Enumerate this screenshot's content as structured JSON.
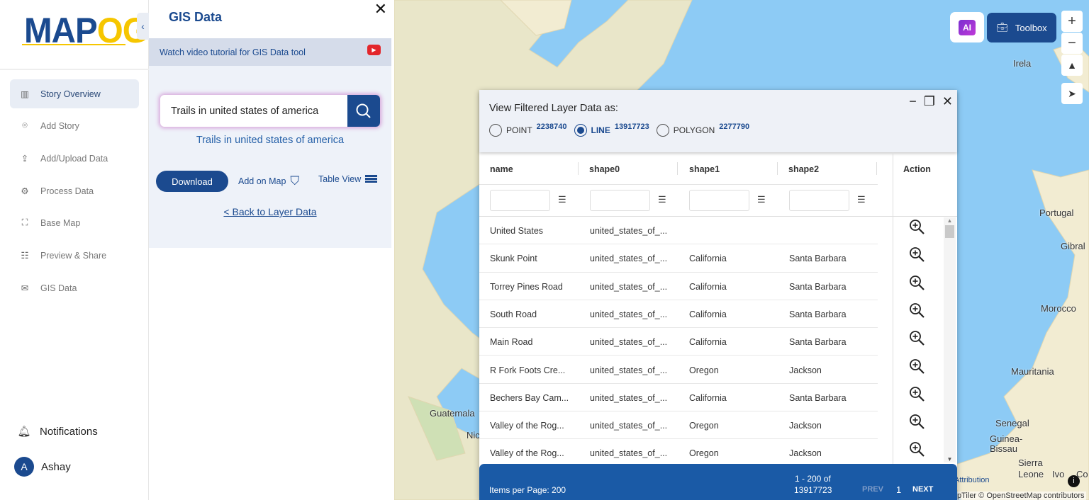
{
  "sidebar": {
    "logo": "MAPOG",
    "items": [
      {
        "label": "Story Overview",
        "icon": "map-icon"
      },
      {
        "label": "Add Story",
        "icon": "location-pin-icon"
      },
      {
        "label": "Add/Upload Data",
        "icon": "upload-file-icon"
      },
      {
        "label": "Process Data",
        "icon": "process-gear-icon"
      },
      {
        "label": "Base Map",
        "icon": "base-map-icon"
      },
      {
        "label": "Preview & Share",
        "icon": "preview-icon"
      },
      {
        "label": "GIS Data",
        "icon": "gis-data-icon"
      }
    ],
    "notifications": "Notifications",
    "user": {
      "initial": "A",
      "name": "Ashay"
    }
  },
  "panel": {
    "title": "GIS Data",
    "tutorial": "Watch video tutorial for GIS Data tool",
    "search_value": "Trails in united states of america",
    "search_echo": "Trails in united states of america",
    "download": "Download",
    "add_on_map": "Add on Map",
    "table_view": "Table View",
    "back": "< Back to Layer Data"
  },
  "map": {
    "toolbox": "Toolbox",
    "labels": [
      "Irela",
      "Portugal",
      "Gibral",
      "Morocco",
      "Mauritania",
      "Senegal",
      "Guinea-",
      "Bissau",
      "Sierra",
      "Leone",
      "Ivo",
      "Co",
      "Guatemala",
      "Nic"
    ],
    "attribution": "Attribution",
    "credits": "pTiler © OpenStreetMap contributors",
    "colors": {
      "ocean": "#8dcbf5",
      "land": "#f2ecd2",
      "accent": "#1b4a8f"
    }
  },
  "dialog": {
    "question": "View Filtered Layer Data as:",
    "options": [
      {
        "label": "POINT",
        "count": "2238740",
        "selected": false
      },
      {
        "label": "LINE",
        "count": "13917723",
        "selected": true
      },
      {
        "label": "POLYGON",
        "count": "2277790",
        "selected": false
      }
    ],
    "columns": [
      "name",
      "shape0",
      "shape1",
      "shape2",
      "Action"
    ],
    "rows": [
      [
        "United States",
        "united_states_of_...",
        "",
        ""
      ],
      [
        "Skunk Point",
        "united_states_of_...",
        "California",
        "Santa Barbara"
      ],
      [
        "Torrey Pines Road",
        "united_states_of_...",
        "California",
        "Santa Barbara"
      ],
      [
        "South Road",
        "united_states_of_...",
        "California",
        "Santa Barbara"
      ],
      [
        "Main Road",
        "united_states_of_...",
        "California",
        "Santa Barbara"
      ],
      [
        "R Fork Foots Cre...",
        "united_states_of_...",
        "Oregon",
        "Jackson"
      ],
      [
        "Bechers Bay Cam...",
        "united_states_of_...",
        "California",
        "Santa Barbara"
      ],
      [
        "Valley of the Rog...",
        "united_states_of_...",
        "Oregon",
        "Jackson"
      ],
      [
        "Valley of the Rog...",
        "united_states_of_...",
        "Oregon",
        "Jackson"
      ]
    ],
    "footer": {
      "items_per_page": "Items per Page: 200",
      "range": "1 - 200 of",
      "total": "13917723",
      "prev": "PREV",
      "page": "1",
      "next": "NEXT"
    }
  }
}
